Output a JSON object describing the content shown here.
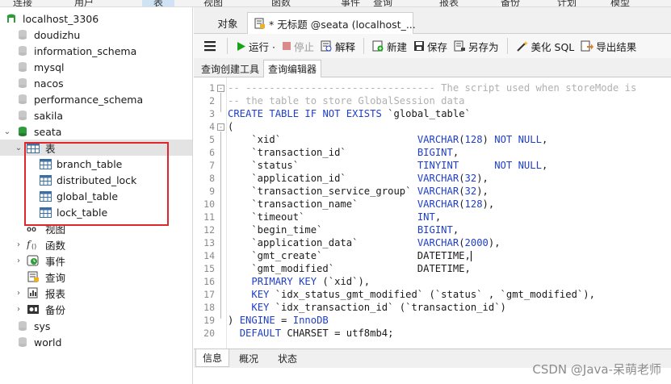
{
  "menu": {
    "items": [
      "连接",
      "用户",
      "表",
      "视图",
      "函数",
      "事件",
      "查询",
      "报表",
      "备份",
      "计划",
      "模型"
    ]
  },
  "sidebar": {
    "connection": "localhost_3306",
    "databases": [
      "doudizhu",
      "information_schema",
      "mysql",
      "nacos",
      "performance_schema",
      "sakila",
      "seata"
    ],
    "seata_children": {
      "tables_folder": "表",
      "tables": [
        "branch_table",
        "distributed_lock",
        "global_table",
        "lock_table"
      ],
      "others": [
        "视图",
        "函数",
        "事件",
        "查询",
        "报表",
        "备份"
      ]
    },
    "databases_after": [
      "sys",
      "world"
    ],
    "colors": {
      "db_icon": "#c8c8c8",
      "db_active": "#2e9c3a",
      "table_icon": "#3a6ea5",
      "highlight_box": "#e0262b"
    }
  },
  "tabs": {
    "objects": "对象",
    "query_tab": "* 无标题 @seata (localhost_..."
  },
  "toolbar": {
    "menu_icon": "hamburger-icon",
    "run": "运行 ·",
    "stop": "停止",
    "explain": "解释",
    "new": "新建",
    "save": "保存",
    "save_as": "另存为",
    "beautify": "美化 SQL",
    "export": "导出结果"
  },
  "editor_tabs": {
    "builder": "查询创建工具",
    "editor": "查询编辑器"
  },
  "code_lines": [
    "-- -------------------------------- The script used when storeMode is",
    "-- the table to store GlobalSession data",
    "CREATE TABLE IF NOT EXISTS `global_table`",
    "(",
    "    `xid`                       VARCHAR(128) NOT NULL,",
    "    `transaction_id`            BIGINT,",
    "    `status`                    TINYINT      NOT NULL,",
    "    `application_id`            VARCHAR(32),",
    "    `transaction_service_group` VARCHAR(32),",
    "    `transaction_name`          VARCHAR(128),",
    "    `timeout`                   INT,",
    "    `begin_time`                BIGINT,",
    "    `application_data`          VARCHAR(2000),",
    "    `gmt_create`                DATETIME,",
    "    `gmt_modified`              DATETIME,",
    "    PRIMARY KEY (`xid`),",
    "    KEY `idx_status_gmt_modified` (`status` , `gmt_modified`),",
    "    KEY `idx_transaction_id` (`transaction_id`)",
    ") ENGINE = InnoDB",
    "  DEFAULT CHARSET = utf8mb4;"
  ],
  "bottom_tabs": [
    "信息",
    "概况",
    "状态"
  ],
  "watermark": "CSDN @Java-呆萌老师",
  "colors": {
    "keyword": "#1f3fc9",
    "comment": "#b0b0b0",
    "run_green": "#19a319",
    "stop_red": "#d23b3b"
  }
}
